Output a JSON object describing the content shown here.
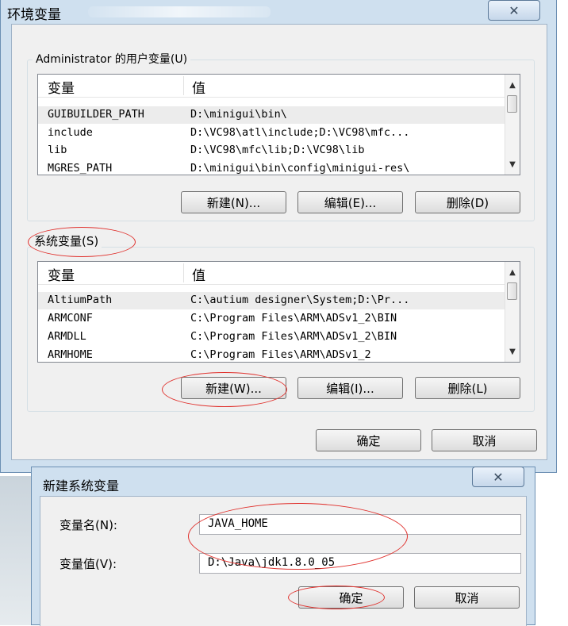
{
  "env_dialog": {
    "title": "环境变量",
    "close_glyph": "✕",
    "user_group_label": "Administrator 的用户变量(U)",
    "user_vars": {
      "headers": [
        "变量",
        "值"
      ],
      "rows": [
        [
          "GUIBUILDER_PATH",
          "D:\\minigui\\bin\\"
        ],
        [
          "include",
          "D:\\VC98\\atl\\include;D:\\VC98\\mfc..."
        ],
        [
          "lib",
          "D:\\VC98\\mfc\\lib;D:\\VC98\\lib"
        ],
        [
          "MGRES_PATH",
          "D:\\minigui\\bin\\config\\minigui-res\\"
        ]
      ],
      "buttons": {
        "new": "新建(N)...",
        "edit": "编辑(E)...",
        "delete": "删除(D)"
      }
    },
    "system_group_label": "系统变量(S)",
    "system_vars": {
      "headers": [
        "变量",
        "值"
      ],
      "rows": [
        [
          "AltiumPath",
          "C:\\autium designer\\System;D:\\Pr..."
        ],
        [
          "ARMCONF",
          "C:\\Program Files\\ARM\\ADSv1_2\\BIN"
        ],
        [
          "ARMDLL",
          "C:\\Program Files\\ARM\\ADSv1_2\\BIN"
        ],
        [
          "ARMHOME",
          "C:\\Program Files\\ARM\\ADSv1_2"
        ]
      ],
      "buttons": {
        "new": "新建(W)...",
        "edit": "编辑(I)...",
        "delete": "删除(L)"
      }
    },
    "footer": {
      "ok": "确定",
      "cancel": "取消"
    }
  },
  "new_dialog": {
    "title": "新建系统变量",
    "close_glyph": "✕",
    "name_label": "变量名(N):",
    "name_value": "JAVA_HOME",
    "value_label": "变量值(V):",
    "value_value": "D:\\Java\\jdk1.8.0_05",
    "ok": "确定",
    "cancel": "取消"
  },
  "colors": {
    "annotation": "#e0312d",
    "title_bar": "#cfe0ef"
  }
}
